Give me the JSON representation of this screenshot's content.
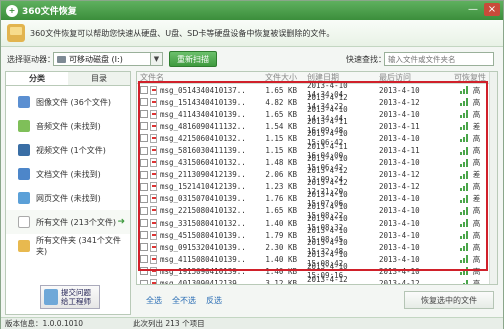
{
  "window": {
    "title": "360文件恢复",
    "minimize": "—",
    "close": "×"
  },
  "banner": {
    "text": "360文件恢复可以帮助您快速从硬盘、U盘、SD卡等硬盘设备中恢复被误删除的文件。"
  },
  "toolbar": {
    "drive_label": "选择驱动器：",
    "drive_value": "可移动磁盘 (I:)",
    "rescan_label": "重新扫描",
    "quick_search_label": "快速查找：",
    "quick_search_placeholder": "输入文件或文件夹名"
  },
  "sidebar": {
    "tabs": [
      "分类",
      "目录"
    ],
    "items": [
      {
        "label": "图像文件 (36个文件)",
        "color": "#5b8fd1"
      },
      {
        "label": "音频文件 (未找到)",
        "color": "#7fbf59"
      },
      {
        "label": "视频文件 (1个文件)",
        "color": "#3a6ea5"
      },
      {
        "label": "文档文件 (未找到)",
        "color": "#4d86c9"
      },
      {
        "label": "网页文件 (未找到)",
        "color": "#5ba0d8"
      },
      {
        "label": "所有文件 (213个文件)",
        "color": "#e6c36b"
      },
      {
        "label": "所有文件夹 (341个文件夹)",
        "color": "#e8b94f"
      }
    ],
    "submit_line1": "提交问题",
    "submit_line2": "给工程师"
  },
  "table": {
    "headers": [
      "文件名",
      "文件大小",
      "创建日期",
      "最后访问",
      "可恢复性"
    ],
    "rows": [
      {
        "name": "msg_0514340410137...",
        "size": "1.65 KB",
        "created": "2013-4-10 14:34:04",
        "accessed": "2013-4-10",
        "rec": "高"
      },
      {
        "name": "msg_1514340410139...",
        "size": "4.82 KB",
        "created": "2013-4-12 14:34:22",
        "accessed": "2013-4-12",
        "rec": "高"
      },
      {
        "name": "msg_4114340410139...",
        "size": "1.65 KB",
        "created": "2013-4-10 14:34:44",
        "accessed": "2013-4-10",
        "rec": "高"
      },
      {
        "name": "msg_4816090411132...",
        "size": "1.54 KB",
        "created": "2013-4-11 16:09:48",
        "accessed": "2013-4-11",
        "rec": "差"
      },
      {
        "name": "msg_4215060410132...",
        "size": "1.15 KB",
        "created": "2013-4-10 15:06:42",
        "accessed": "2013-4-10",
        "rec": "高"
      },
      {
        "name": "msg_5816030411139...",
        "size": "1.15 KB",
        "created": "2013-4-11 16:04:00",
        "accessed": "2013-4-11",
        "rec": "高"
      },
      {
        "name": "msg_4315060410132...",
        "size": "1.48 KB",
        "created": "2013-4-10 15:06:42",
        "accessed": "2013-4-10",
        "rec": "高"
      },
      {
        "name": "msg_2113090412139...",
        "size": "2.06 KB",
        "created": "2013-4-12 13:09:24",
        "accessed": "2013-4-12",
        "rec": "差"
      },
      {
        "name": "msg_1521410412139...",
        "size": "1.23 KB",
        "created": "2013-4-12 12:21:20",
        "accessed": "2013-4-12",
        "rec": "高"
      },
      {
        "name": "msg_0315070410139...",
        "size": "1.76 KB",
        "created": "2013-4-10 15:07:06",
        "accessed": "2013-4-10",
        "rec": "差"
      },
      {
        "name": "msg_2215080410132...",
        "size": "1.65 KB",
        "created": "2013-4-10 15:08:22",
        "accessed": "2013-4-10",
        "rec": "高"
      },
      {
        "name": "msg_3315080410132...",
        "size": "1.40 KB",
        "created": "2013-4-10 15:08:32",
        "accessed": "2013-4-10",
        "rec": "高"
      },
      {
        "name": "msg_4515080410139...",
        "size": "1.79 KB",
        "created": "2013-4-10 15:08:45",
        "accessed": "2013-4-10",
        "rec": "高"
      },
      {
        "name": "msg_0915320410139...",
        "size": "2.30 KB",
        "created": "2013-4-10 15:32:48",
        "accessed": "2013-4-10",
        "rec": "高"
      },
      {
        "name": "msg_4115080410139...",
        "size": "1.40 KB",
        "created": "2013-4-10 15:08:42",
        "accessed": "2013-4-10",
        "rec": "高"
      },
      {
        "name": "msg_1915090410139...",
        "size": "1.40 KB",
        "created": "2013-4-10 15:09:16",
        "accessed": "2013-4-10",
        "rec": "高"
      },
      {
        "name": "msg_4013090412139...",
        "size": "3.12 KB",
        "created": "2013-4-12 13:09:40",
        "accessed": "2013-4-12",
        "rec": "高"
      }
    ]
  },
  "actions": {
    "select_all": "全选",
    "select_none": "全不选",
    "invert": "反选",
    "recover": "恢复选中的文件"
  },
  "status": {
    "version": "版本信息：1.0.0.1010",
    "listed": "此次列出 213 个项目"
  },
  "colors": {
    "accent": "#3e9a3e",
    "highlight_border": "#d0202a"
  }
}
